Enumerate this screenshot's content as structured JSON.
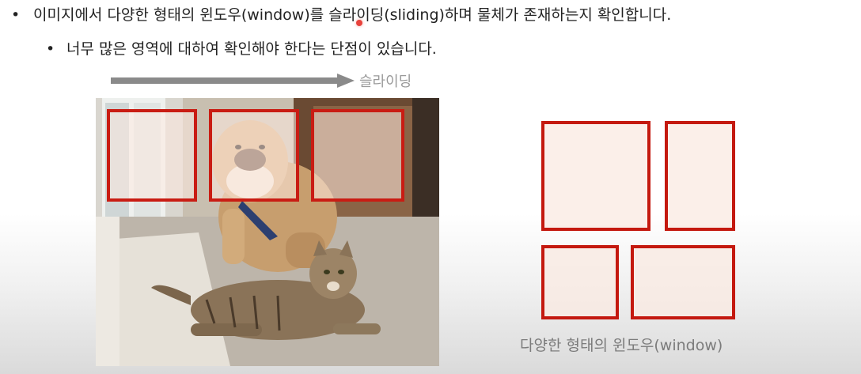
{
  "bullets": {
    "line1": "이미지에서 다양한 형태의 윈도우(window)를 슬라이딩(sliding)하며 물체가 존재하는지 확인합니다.",
    "line2": "너무 많은 영역에 대하여 확인해야 한다는 단점이 있습니다.",
    "bullet_char": "•"
  },
  "arrow": {
    "label": "슬라이딩"
  },
  "illustration": {
    "caption": "다양한 형태의 윈도우(window)"
  },
  "colors": {
    "window_border": "#c91c13",
    "arrow": "#8a8a8a"
  }
}
